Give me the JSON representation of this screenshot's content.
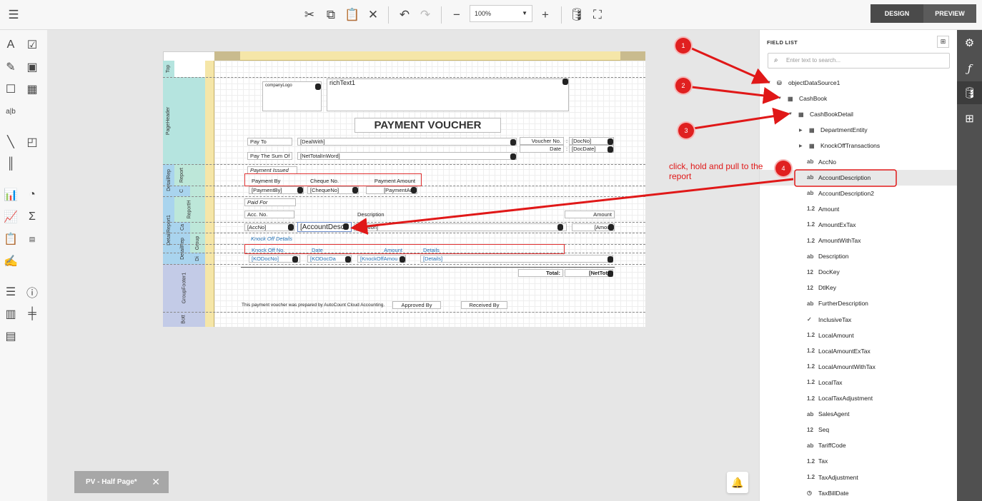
{
  "toolbar": {
    "zoom_value": "100%",
    "design_label": "DESIGN",
    "preview_label": "PREVIEW",
    "colors": {
      "design_bg": "#4a4a4a",
      "preview_bg": "#5b5b5b"
    }
  },
  "report": {
    "bands": {
      "top": "Top",
      "page_header": "PageHeader",
      "detail_report": "DetailRep",
      "report_header": "Report",
      "c": "C",
      "report_header2": "ReportH",
      "detail_report1": "DetailReport1",
      "ca": "Ca",
      "detail_rep2": "DetailRep",
      "group": "Group",
      "di": "Di",
      "group_footer": "GroupFooter1",
      "bottom": "Bott"
    },
    "header": {
      "company_logo": "companyLogo",
      "rich_text": "richText1",
      "title": "PAYMENT VOUCHER",
      "pay_to": "Pay To",
      "deal_with": "[DealWith]",
      "voucher_no": "Voucher No.",
      "colon1": ":",
      "doc_no": "[DocNo]",
      "date": "Date",
      "colon2": ":",
      "doc_date": "[DocDate]",
      "pay_sum": "Pay The Sum Of",
      "net_total_word": "[NetTotalInWord]"
    },
    "payment": {
      "issued": "Payment Issued",
      "payment_by": "Payment By",
      "cheque_no": "Cheque No.",
      "payment_amount": "Payment Amount",
      "payment_by_field": "[PaymentBy]",
      "cheque_no_field": "[ChequeNo]",
      "payment_amount_field": "[PaymentAm"
    },
    "paid_for": {
      "label": "Paid For",
      "acc_no": "Acc. No.",
      "description": "Description",
      "amount": "Amount",
      "acc_no_field": "[AccNo]",
      "account_desc_field": "[AccountDesc",
      "description_field": "scription]",
      "amount_field": "[Amour"
    },
    "knock_off": {
      "label": "Knock Off Details",
      "knock_off_no": "Knock Off No.",
      "date": "Date",
      "amount": "Amount",
      "details": "Details",
      "ko_doc_no": "[KODocNo]",
      "ko_doc_date": "[KODocDa",
      "ko_amount": "[KnockOffAmou",
      "details_field": "[Details]"
    },
    "footer": {
      "total": "Total:",
      "net_total": "[NetTota",
      "prepared_by": "This payment voucher was prepared by AutoCount Cloud Accounting.",
      "approved_by": "Approved By",
      "received_by": "Received By"
    }
  },
  "bottom_tab": {
    "label": "PV - Half Page*"
  },
  "field_list": {
    "title": "FIELD LIST",
    "search_placeholder": "Enter text to search...",
    "items": [
      {
        "label": "objectDataSource1",
        "icon": "ds"
      },
      {
        "label": "CashBook",
        "icon": "tbl"
      },
      {
        "label": "CashBookDetail",
        "icon": "tbl"
      },
      {
        "label": "DepartmentEntity",
        "icon": "tbl"
      },
      {
        "label": "KnockOffTransactions",
        "icon": "tbl"
      },
      {
        "label": "AccNo",
        "icon": "ab"
      },
      {
        "label": "AccountDescription",
        "icon": "ab"
      },
      {
        "label": "AccountDescription2",
        "icon": "ab"
      },
      {
        "label": "Amount",
        "icon": "1.2"
      },
      {
        "label": "AmountExTax",
        "icon": "1.2"
      },
      {
        "label": "AmountWithTax",
        "icon": "1.2"
      },
      {
        "label": "Description",
        "icon": "ab"
      },
      {
        "label": "DocKey",
        "icon": "12"
      },
      {
        "label": "DtlKey",
        "icon": "12"
      },
      {
        "label": "FurtherDescription",
        "icon": "ab"
      },
      {
        "label": "InclusiveTax",
        "icon": "check"
      },
      {
        "label": "LocalAmount",
        "icon": "1.2"
      },
      {
        "label": "LocalAmountExTax",
        "icon": "1.2"
      },
      {
        "label": "LocalAmountWithTax",
        "icon": "1.2"
      },
      {
        "label": "LocalTax",
        "icon": "1.2"
      },
      {
        "label": "LocalTaxAdjustment",
        "icon": "1.2"
      },
      {
        "label": "SalesAgent",
        "icon": "ab"
      },
      {
        "label": "Seq",
        "icon": "12"
      },
      {
        "label": "TariffCode",
        "icon": "ab"
      },
      {
        "label": "Tax",
        "icon": "1.2"
      },
      {
        "label": "TaxAdjustment",
        "icon": "1.2"
      },
      {
        "label": "TaxBillDate",
        "icon": "clock"
      }
    ]
  },
  "annotations": {
    "step1": "1",
    "step2": "2",
    "step3": "3",
    "step4": "4",
    "instruction": "click, hold and pull to the report",
    "color": "#e01818"
  }
}
